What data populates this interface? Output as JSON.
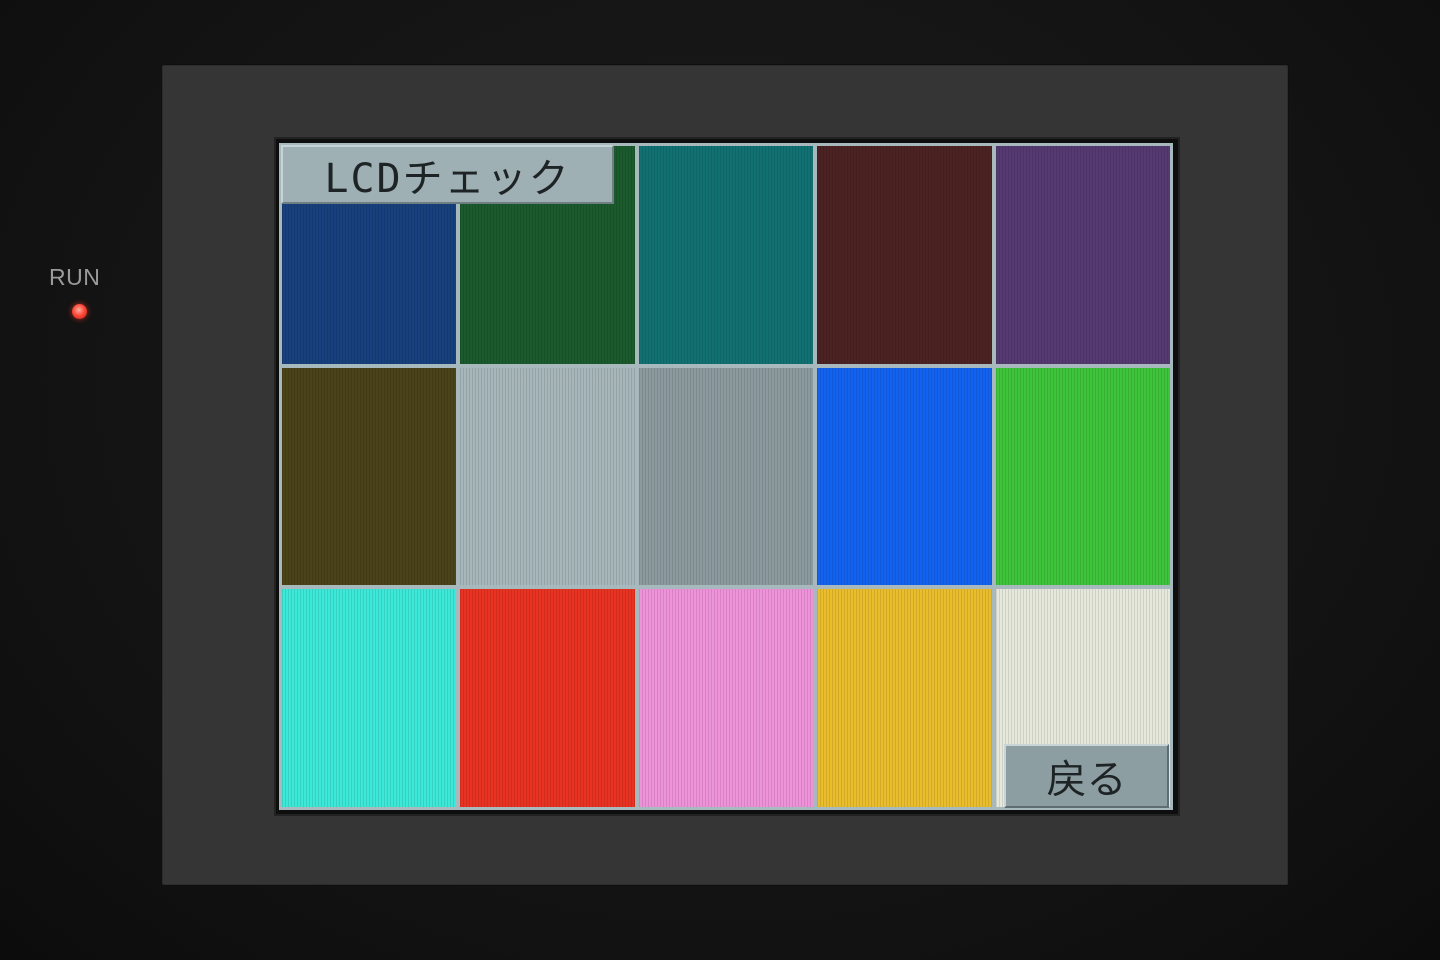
{
  "device": {
    "run_label": "RUN",
    "run_led_color": "#ff4a3a"
  },
  "screen": {
    "title": "LCDチェック",
    "back_label": "戻る",
    "swatches": [
      [
        "#17407c",
        "#1b5a2c",
        "#117172",
        "#4c2222",
        "#553a72"
      ],
      [
        "#4a4219",
        "#a6b6ba",
        "#8a9a9e",
        "#1363f0",
        "#3dc43a"
      ],
      [
        "#3ce9d8",
        "#e83222",
        "#ee92d9",
        "#eabd2c",
        "#e6e8dc"
      ]
    ]
  }
}
